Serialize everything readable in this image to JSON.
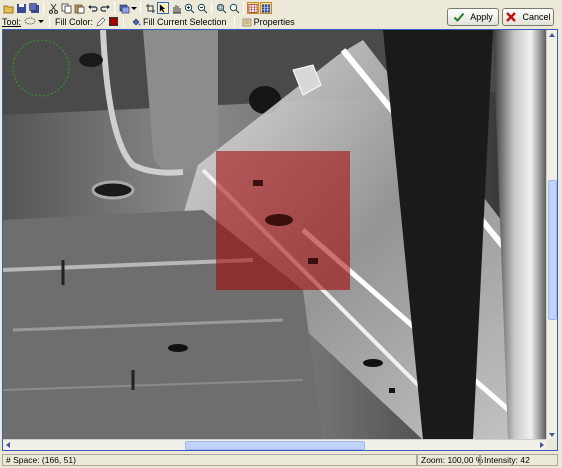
{
  "toolbar2": {
    "tool_label": "Tool:",
    "fill_color_label": "Fill Color:",
    "fill_current_selection": "Fill Current Selection",
    "properties": "Properties",
    "fill_color": "#a40000"
  },
  "dialog": {
    "apply": "Apply",
    "cancel": "Cancel"
  },
  "status": {
    "space": "# Space: (166, 51)",
    "zoom": "Zoom: 100,00 %",
    "intensity": "Intensity: 42"
  },
  "colors": {
    "selection_fill": "#a40000",
    "brush_circle": "#2aa02a",
    "apply_check": "#2a7a2a",
    "cancel_x": "#c01010"
  }
}
